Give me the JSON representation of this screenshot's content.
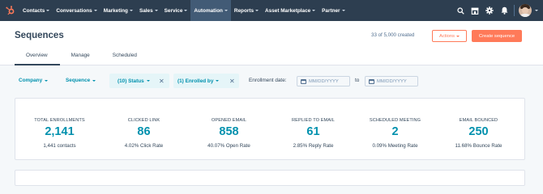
{
  "nav": {
    "items": [
      {
        "label": "Contacts"
      },
      {
        "label": "Conversations"
      },
      {
        "label": "Marketing"
      },
      {
        "label": "Sales"
      },
      {
        "label": "Service"
      },
      {
        "label": "Automation"
      },
      {
        "label": "Reports"
      },
      {
        "label": "Asset Marketplace"
      },
      {
        "label": "Partner"
      }
    ],
    "active": "Automation",
    "right_icons": [
      "search-icon",
      "marketplace-icon",
      "settings-icon",
      "notifications-icon"
    ],
    "colors": {
      "background": "#2d3e50",
      "active": "#425b76",
      "logo": "#ff7a59"
    }
  },
  "header": {
    "title": "Sequences",
    "created_count": "33 of 5,000 created",
    "actions_label": "Actions",
    "create_label": "Create sequence",
    "tabs": [
      {
        "label": "Overview"
      },
      {
        "label": "Manage"
      },
      {
        "label": "Scheduled"
      }
    ],
    "active_tab": "Overview"
  },
  "filters": {
    "company_label": "Company",
    "sequence_label": "Sequence",
    "status_label": "(10) Status",
    "enrolled_by_label": "(1) Enrolled by",
    "enrollment_date_label": "Enrollment date:",
    "start_placeholder": "MM/DD/YYYY",
    "to_label": "to",
    "end_placeholder": "MM/DD/YYYY"
  },
  "stats": [
    {
      "label": "TOTAL ENROLLMENTS",
      "value": "2,141",
      "sub": "1,441 contacts"
    },
    {
      "label": "CLICKED LINK",
      "value": "86",
      "sub": "4.02% Click Rate"
    },
    {
      "label": "OPENED EMAIL",
      "value": "858",
      "sub": "40.07% Open Rate"
    },
    {
      "label": "REPLIED TO EMAIL",
      "value": "61",
      "sub": "2.85% Reply Rate"
    },
    {
      "label": "SCHEDULED MEETING",
      "value": "2",
      "sub": "0.09% Meeting Rate"
    },
    {
      "label": "EMAIL BOUNCED",
      "value": "250",
      "sub": "11.68% Bounce Rate"
    }
  ],
  "colors": {
    "accent": "#0091ae",
    "primary_button": "#ff7a59",
    "text": "#33475b"
  }
}
